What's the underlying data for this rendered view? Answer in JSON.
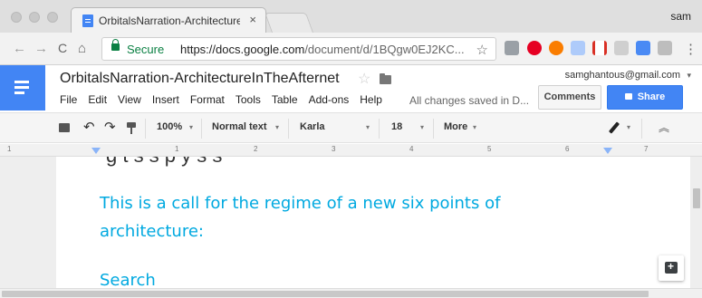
{
  "browser": {
    "tab_title": "OrbitalsNarration-Architecture",
    "tab_close": "×",
    "profile_name": "sam",
    "nav": {
      "back": "←",
      "forward": "→",
      "reload": "C",
      "home": "⌂"
    },
    "secure_label": "Secure",
    "url_host": "https://docs.google.com",
    "url_path": "/document/d/1BQgw0EJ2KC...",
    "bookmark_star": "☆",
    "extension_icons": [
      "docs-ext-icon",
      "pinterest-icon",
      "opera-icon",
      "doc-icon",
      "bars-icon",
      "drive-icon",
      "pencil-ext-icon",
      "camera-icon"
    ],
    "menu_dots": "⋮"
  },
  "docs": {
    "title": "OrbitalsNarration-ArchitectureInTheAfternet",
    "title_star": "☆",
    "menus": [
      "File",
      "Edit",
      "View",
      "Insert",
      "Format",
      "Tools",
      "Table",
      "Add-ons",
      "Help"
    ],
    "save_status": "All changes saved in D...",
    "account_email": "samghantous@gmail.com",
    "account_caret": "▾",
    "comments_label": "Comments",
    "share_label": "Share"
  },
  "toolbar": {
    "undo": "↶",
    "redo": "↷",
    "zoom": "100%",
    "style": "Normal text",
    "font": "Karla",
    "font_size": "18",
    "more": "More",
    "caret": "▾",
    "collapse": "︽"
  },
  "ruler": {
    "numbers": [
      "1",
      "1",
      "2",
      "3",
      "4",
      "5",
      "6",
      "7"
    ]
  },
  "document": {
    "cut_text": "g   t   s   s   p   y   s   s",
    "paragraph": "This is a call for the regime of a new six points of architecture:",
    "next_line": "Search",
    "accent_color": "#00a9e0"
  }
}
